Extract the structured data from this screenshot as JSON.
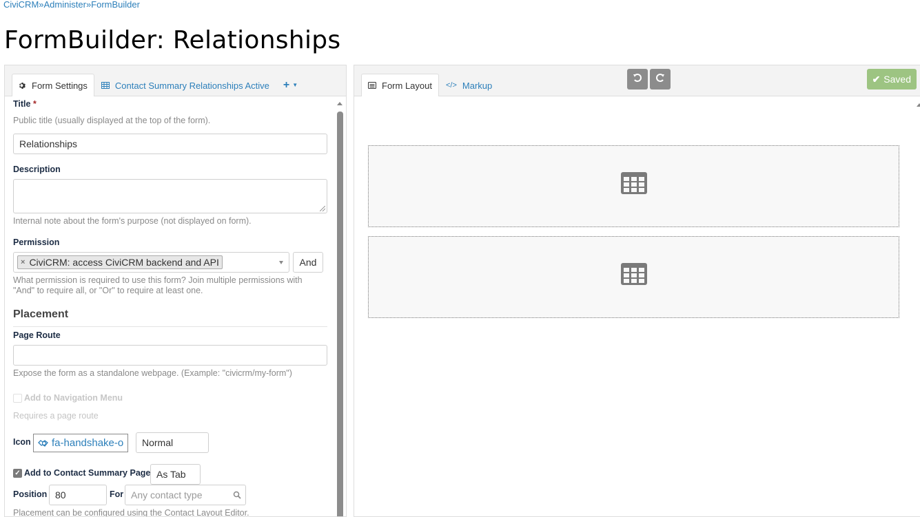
{
  "breadcrumb": [
    {
      "label": "CiviCRM"
    },
    {
      "label": "Administer"
    },
    {
      "label": "FormBuilder"
    }
  ],
  "breadcrumb_separator": "»",
  "page_title": "FormBuilder: Relationships",
  "left_panel": {
    "tabs": [
      {
        "label": "Form Settings",
        "icon": "gear-icon",
        "active": true
      },
      {
        "label": "Contact Summary Relationships Active",
        "icon": "table-icon",
        "active": false
      }
    ],
    "add_tab_icon": "plus-icon",
    "form": {
      "title_label": "Title",
      "title_required_mark": "*",
      "title_help": "Public title (usually displayed at the top of the form).",
      "title_value": "Relationships",
      "description_label": "Description",
      "description_value": "",
      "description_help": "Internal note about the form's purpose (not displayed on form).",
      "permission_label": "Permission",
      "permission_selected": "CiviCRM: access CiviCRM backend and API",
      "permission_operator": "And",
      "permission_help_1": "What permission is required to use this form? Join multiple permissions with",
      "permission_help_2": "\"And\" to require all, or \"Or\" to require at least one.",
      "placement_heading": "Placement",
      "page_route_label": "Page Route",
      "page_route_value": "",
      "page_route_help": "Expose the form as a standalone webpage. (Example: \"civicrm/my-form\")",
      "nav_menu_label": "Add to Navigation Menu",
      "nav_menu_checked": false,
      "nav_menu_help": "Requires a page route",
      "icon_label": "Icon",
      "icon_value": "fa-handshake-o",
      "icon_size": "Normal",
      "contact_summary_label": "Add to Contact Summary Page",
      "contact_summary_checked": true,
      "contact_summary_mode": "As Tab",
      "position_label": "Position",
      "position_value": "80",
      "for_label": "For",
      "for_placeholder": "Any contact type",
      "placement_help": "Placement can be configured using the Contact Layout Editor."
    }
  },
  "right_panel": {
    "tabs": [
      {
        "label": "Form Layout",
        "icon": "list-icon",
        "active": true
      },
      {
        "label": "Markup",
        "icon": "code-icon",
        "active": false
      }
    ],
    "undo_icon": "undo-icon",
    "redo_icon": "redo-icon",
    "saved_label": "Saved",
    "colors": {
      "saved": "#9dc482",
      "toolbar_button": "#8c8c8c",
      "link": "#2c7fba"
    },
    "blocks": [
      {
        "icon": "table-icon"
      },
      {
        "icon": "table-icon"
      }
    ]
  }
}
